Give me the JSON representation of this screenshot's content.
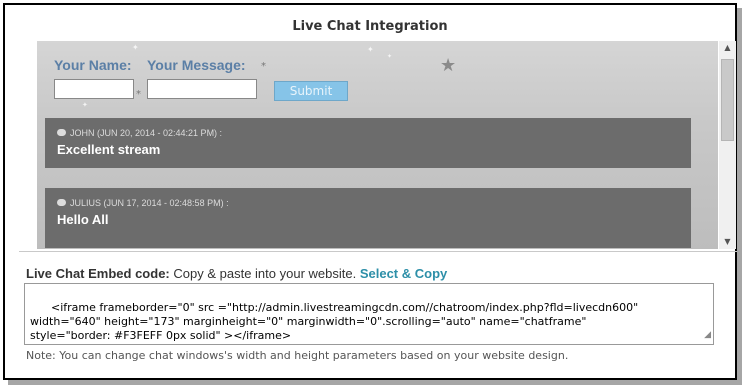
{
  "title": "Live Chat Integration",
  "form": {
    "name_label": "Your Name:",
    "message_label": "Your Message:",
    "submit_label": "Submit"
  },
  "messages": [
    {
      "meta": "JOHN (JUN 20, 2014 - 02:44:21 PM) :",
      "text": "Excellent stream"
    },
    {
      "meta": "JULIUS (JUN 17, 2014 - 02:48:58 PM) :",
      "text": "Hello All"
    }
  ],
  "embed": {
    "label": "Live Chat Embed code:",
    "instruction": "Copy & paste into your website.",
    "select_copy": "Select & Copy",
    "code": "<iframe frameborder=\"0\" src =\"http://admin.livestreamingcdn.com//chatroom/index.php?fld=livecdn600\"\nwidth=\"640\" height=\"173\" marginheight=\"0\" marginwidth=\"0\".scrolling=\"auto\" name=\"chatframe\"\nstyle=\"border: #F3FEFF 0px solid\" ></iframe>",
    "note": "Note: You can change chat windows's width and height parameters based on your website design."
  },
  "colors": {
    "accent_link": "#2d8fa8",
    "message_bg": "#6c6c6c",
    "submit_bg": "#86c4e8"
  }
}
